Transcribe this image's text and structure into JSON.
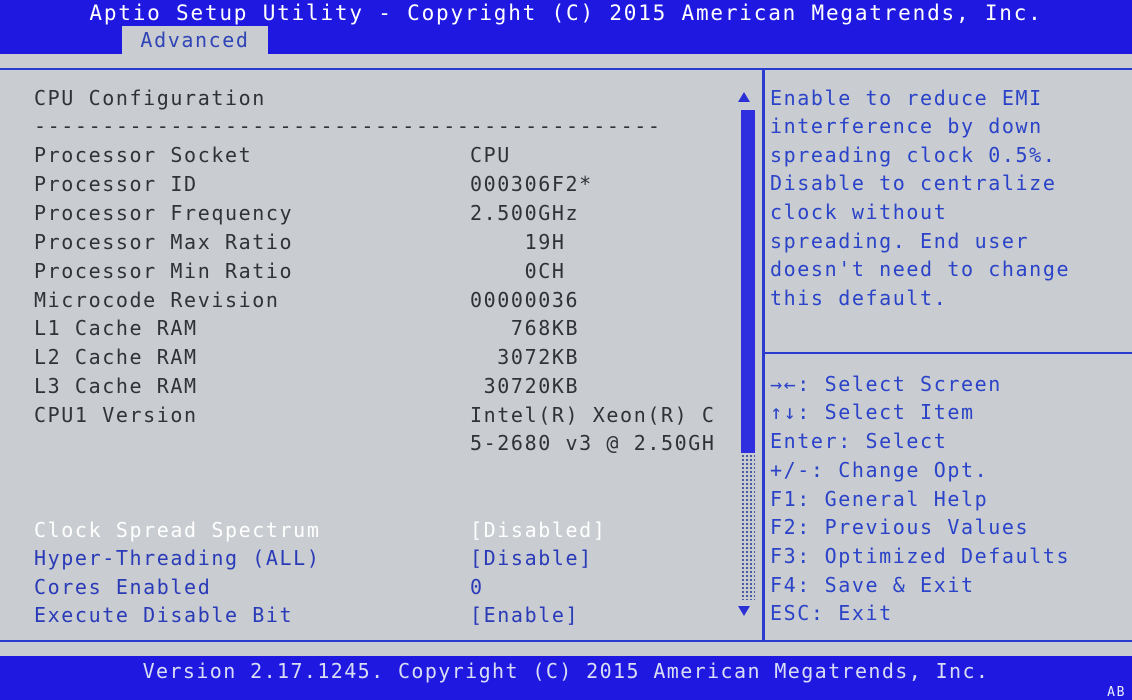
{
  "header": {
    "title": "Aptio Setup Utility - Copyright (C) 2015 American Megatrends, Inc.",
    "active_tab": "Advanced"
  },
  "main": {
    "section_title": "CPU Configuration",
    "separator": "----------------------------------------------",
    "info_rows": [
      {
        "label": "Processor Socket",
        "value": "CPU"
      },
      {
        "label": "Processor ID",
        "value": "000306F2*"
      },
      {
        "label": "Processor Frequency",
        "value": "2.500GHz"
      },
      {
        "label": "Processor Max Ratio",
        "value": "    19H"
      },
      {
        "label": "Processor Min Ratio",
        "value": "    0CH"
      },
      {
        "label": "Microcode Revision",
        "value": "00000036"
      },
      {
        "label": "L1 Cache RAM",
        "value": "   768KB"
      },
      {
        "label": "L2 Cache RAM",
        "value": "  3072KB"
      },
      {
        "label": "L3 Cache RAM",
        "value": " 30720KB"
      },
      {
        "label": "CPU1 Version",
        "value": "Intel(R) Xeon(R) C"
      },
      {
        "label": "",
        "value": "5-2680 v3 @ 2.50GH"
      }
    ],
    "options": [
      {
        "label": "Clock Spread Spectrum",
        "value": "[Disabled]",
        "selected": true
      },
      {
        "label": "Hyper-Threading (ALL)",
        "value": "[Disable]",
        "selected": false
      },
      {
        "label": "Cores Enabled",
        "value": "0",
        "selected": false
      },
      {
        "label": "Execute Disable Bit",
        "value": "[Enable]",
        "selected": false
      }
    ],
    "scroll_position_fraction": 0.0,
    "scroll_visible_fraction": 0.7
  },
  "help": {
    "lines": [
      "Enable to reduce EMI",
      "interference by down",
      "spreading clock 0.5%.",
      "Disable to centralize",
      "clock without",
      "spreading. End user",
      "doesn't need to change",
      "this default."
    ],
    "keys": [
      "→←: Select Screen",
      "↑↓: Select Item",
      "Enter: Select",
      "+/-: Change Opt.",
      "F1: General Help",
      "F2: Previous Values",
      "F3: Optimized Defaults",
      "F4: Save & Exit",
      "ESC: Exit"
    ]
  },
  "footer": {
    "text": "Version 2.17.1245. Copyright (C) 2015 American Megatrends, Inc.",
    "corner": "AB"
  },
  "colors": {
    "header_bg": "#1e18e0",
    "panel_bg": "#c9ccd0",
    "accent_blue": "#2a3bb8",
    "selected_text": "#ffffff",
    "static_text": "#303236"
  }
}
